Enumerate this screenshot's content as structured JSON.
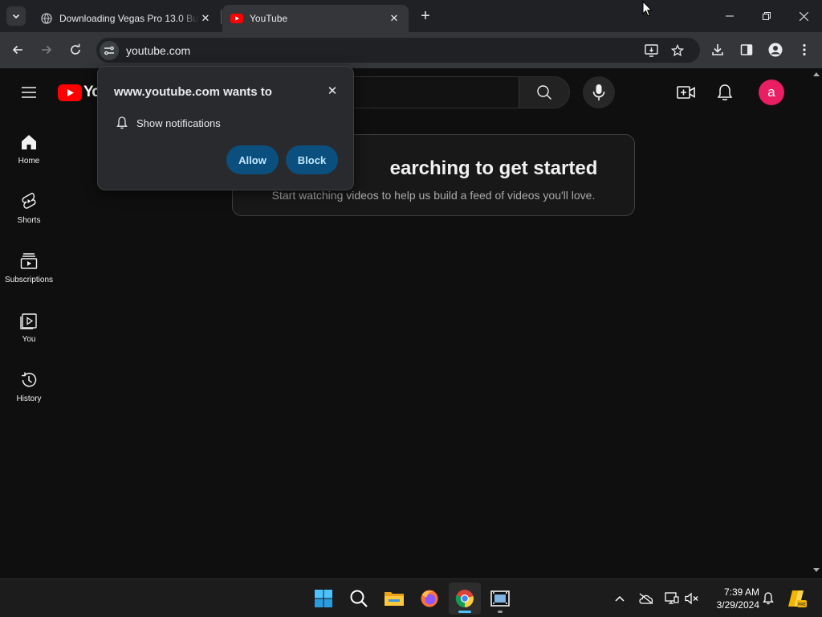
{
  "browser": {
    "tabs": [
      {
        "title": "Downloading Vegas Pro 13.0 Bu",
        "active": false,
        "favicon": "globe-icon"
      },
      {
        "title": "YouTube",
        "active": true,
        "favicon": "youtube-icon"
      }
    ],
    "new_tab_label": "+",
    "url": "youtube.com",
    "window_controls": {
      "minimize": "minimize-icon",
      "restore": "restore-icon",
      "close": "close-icon"
    }
  },
  "youtube": {
    "logo_text": "Yo",
    "avatar_letter": "a",
    "avatar_color": "#e91e63",
    "guide": [
      {
        "label": "Home",
        "icon": "home-icon"
      },
      {
        "label": "Shorts",
        "icon": "shorts-icon"
      },
      {
        "label": "Subscriptions",
        "icon": "subscriptions-icon"
      },
      {
        "label": "You",
        "icon": "you-icon"
      },
      {
        "label": "History",
        "icon": "history-icon"
      }
    ],
    "feed_heading": "earching to get started",
    "feed_subtext": "Start watching videos to help us build a feed of videos you'll love."
  },
  "permission_prompt": {
    "title": "www.youtube.com wants to",
    "item": "Show notifications",
    "allow_label": "Allow",
    "block_label": "Block",
    "button_color": "#0b4f7e"
  },
  "taskbar": {
    "apps": [
      "start-icon",
      "search-icon",
      "file-explorer-icon",
      "firefox-icon",
      "chrome-icon",
      "video-editor-icon"
    ],
    "time": "7:39 AM",
    "date": "3/29/2024"
  }
}
